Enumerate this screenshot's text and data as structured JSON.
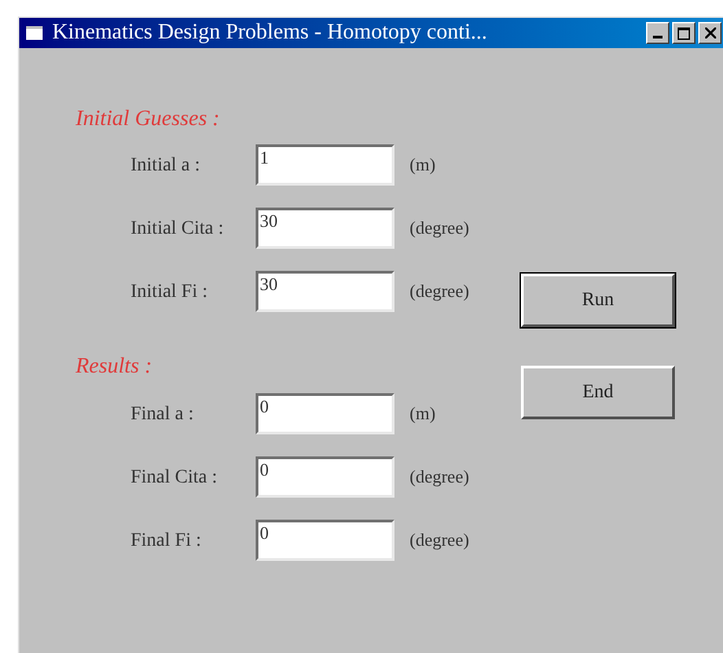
{
  "window": {
    "title": "Kinematics Design Problems - Homotopy conti..."
  },
  "sections": [
    {
      "heading": "Initial Guesses :",
      "fields": [
        {
          "label": "Initial a :",
          "value": "1",
          "unit": "(m)"
        },
        {
          "label": "Initial Cita :",
          "value": "30",
          "unit": "(degree)"
        },
        {
          "label": "Initial Fi :",
          "value": "30",
          "unit": "(degree)"
        }
      ]
    },
    {
      "heading": "Results :",
      "fields": [
        {
          "label": "Final a :",
          "value": "0",
          "unit": "(m)"
        },
        {
          "label": "Final Cita :",
          "value": "0",
          "unit": "(degree)"
        },
        {
          "label": "Final Fi :",
          "value": "0",
          "unit": "(degree)"
        }
      ]
    }
  ],
  "buttons": [
    {
      "label": "Run",
      "selected": true
    },
    {
      "label": "End",
      "selected": false
    }
  ]
}
